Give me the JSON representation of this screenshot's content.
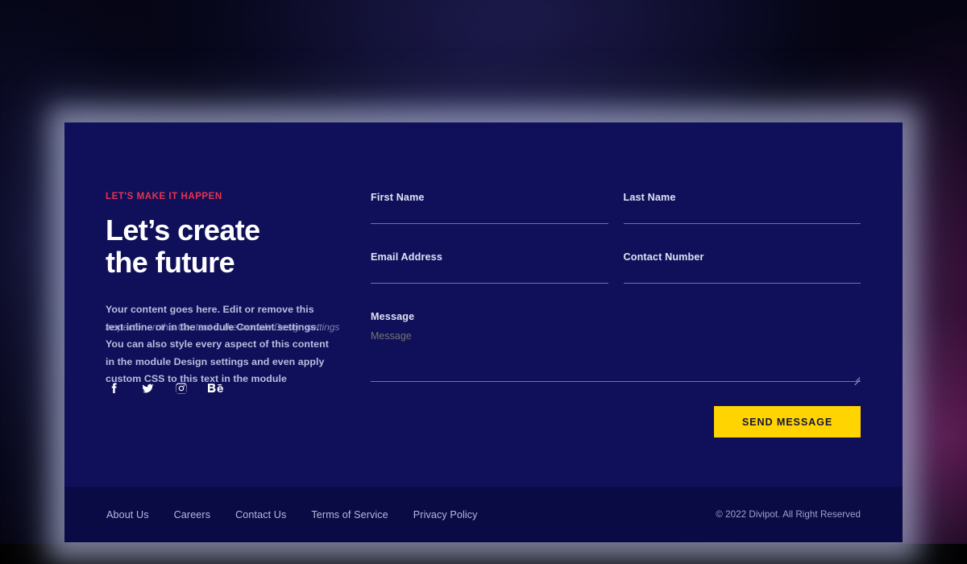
{
  "theme": {
    "panel_bg": "#10105A",
    "footer_bg": "#0A0A44",
    "accent_red": "#E8334D",
    "accent_yellow": "#FFD400",
    "text_light": "#DFE2F5",
    "text_muted": "#B9BDDF",
    "rule_color": "#6F73A8",
    "page_bg": "#050512"
  },
  "left": {
    "eyebrow": "LET'S MAKE IT HAPPEN",
    "headline_line1": "Let’s create",
    "headline_line2": "the future",
    "blurb": "Your content goes here. Edit or remove this text inline or in the module Content settings. You can also style every aspect of this content in the module Design settings and even apply custom CSS to this text in the module",
    "blurb_ghost": "inspector on this Content in the module Design settings and",
    "social": [
      {
        "name": "facebook-icon",
        "label": "Facebook"
      },
      {
        "name": "twitter-icon",
        "label": "Twitter"
      },
      {
        "name": "instagram-icon",
        "label": "Instagram"
      },
      {
        "name": "behance-icon",
        "label": "Behance"
      }
    ]
  },
  "form": {
    "fields": {
      "first_name": {
        "label": "First Name",
        "value": "",
        "placeholder": "First Name"
      },
      "last_name": {
        "label": "Last Name",
        "value": "",
        "placeholder": "Last Name"
      },
      "email": {
        "label": "Email Address",
        "value": "",
        "placeholder": "Email Address"
      },
      "contact_number": {
        "label": "Contact Number",
        "value": "",
        "placeholder": "Contact Number"
      },
      "message": {
        "label": "Message",
        "value": "",
        "placeholder": "Message"
      }
    },
    "submit_label": "SEND MESSAGE"
  },
  "footer": {
    "links": [
      {
        "label": "About Us"
      },
      {
        "label": "Careers"
      },
      {
        "label": "Contact Us"
      },
      {
        "label": "Terms of Service"
      },
      {
        "label": "Privacy Policy"
      }
    ],
    "copyright": "© 2022 Divipot. All Right Reserved"
  }
}
